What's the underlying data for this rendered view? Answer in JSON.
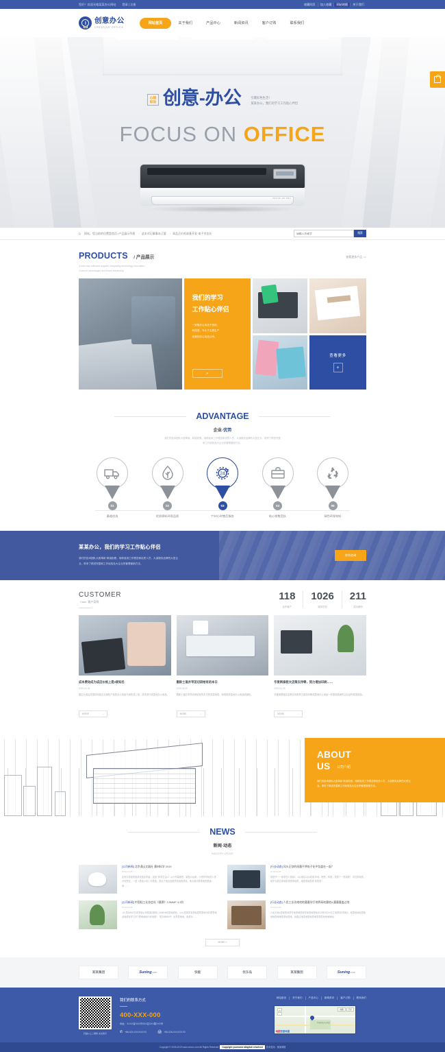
{
  "topbar": {
    "left": [
      "您好！欢迎光临某某办公网站",
      "登录 | 注册"
    ],
    "right": [
      {
        "label": "收藏网页",
        "active": false
      },
      {
        "label": "加入收藏",
        "active": false
      },
      {
        "label": "网站地图",
        "active": true
      },
      {
        "label": "关于我们",
        "active": false
      }
    ]
  },
  "header": {
    "logo_cn": "创意办公",
    "logo_en": "CREATIVE OFFICE",
    "nav": [
      {
        "label": "网站首页",
        "active": true
      },
      {
        "label": "关于我们",
        "active": false
      },
      {
        "label": "产品中心",
        "active": false
      },
      {
        "label": "新闻资讯",
        "active": false
      },
      {
        "label": "客户订购",
        "active": false
      },
      {
        "label": "联系我们",
        "active": false
      }
    ]
  },
  "banner": {
    "badge_line1": "心随",
    "badge_line2": "彩动",
    "title": "创意-办公",
    "sub1": "引爆彩色生活！",
    "sub2": "某某办公，我们的学习工作贴心伴侣",
    "focus_grey": "FOCUS ON ",
    "focus_orange": "OFFICE",
    "printer_label": "OFFICE JET PRO",
    "side_button_icon": "shopping-bag-icon"
  },
  "strip": {
    "home_icon": "home-icon",
    "breadcrumb": "网站，您当前的位置是首页>产品展示列表",
    "keywords": [
      "这本式记事事本订要",
      "高品正价纸收基开发·电子学金业"
    ],
    "search_value": "",
    "search_placeholder": "请输入关键字",
    "search_button": "搜索"
  },
  "products": {
    "en": "PRODUCTS",
    "cn": "/ 产品展示",
    "desc_line1": "A new way software supplier integrating technology innovation",
    "desc_line2": "Channel advantages and brand leadership",
    "more": "查看更多产品 >>",
    "tile_title_line1": "我们的学习",
    "tile_title_line2": "工作贴心伴侣",
    "tile_desc_line1": "一家集办公用品于造纸、",
    "tile_desc_line2": "科技型，专业于文具生产",
    "tile_desc_line3": "经营的办公用品公司。",
    "tile_arrow": ">",
    "blue_title": "查看更多",
    "blue_plus": "+"
  },
  "advantage": {
    "en": "ADVANTAGE",
    "cn_plain": "企业·",
    "cn_bold": "优势",
    "desc_line1": "我们的技术团队大胆革新、精诚勤恳，用精准用工作理念和优质人员，大诚服务品牌的大型企业，带来了精进完整",
    "desc_line2": "和工作经验及大企业的管理营销方法。",
    "items": [
      {
        "num": "01",
        "label": "渠道优选",
        "icon": "truck-icon",
        "active": false
      },
      {
        "num": "02",
        "label": "优质原料环保品质",
        "icon": "leaf-drop-icon",
        "active": false
      },
      {
        "num": "03",
        "label": "7*24小时售后服务",
        "icon": "24-hours-icon",
        "active": true
      },
      {
        "num": "04",
        "label": "贴心销售团队",
        "icon": "briefcase-icon",
        "active": false
      },
      {
        "num": "05",
        "label": "绿色环保材料",
        "icon": "recycle-icon",
        "active": false
      }
    ]
  },
  "cta": {
    "title": "某某办公，我们的学习工作贴心伴侣",
    "desc_line1": "我们的技术团队大胆革新·精诚勤恳，用精准用工作理念和优质人员，大诚服务品牌的大型企",
    "desc_line2": "业，带来了精进完整和工作经验及大企业的管理营销方法。",
    "button": "合作咨询"
  },
  "customer": {
    "en": "CUSTOMER",
    "cn": "Case",
    "cn_small": "客户案例",
    "stats": [
      {
        "number": "118",
        "label": "合作客户"
      },
      {
        "number": "1026",
        "label": "服务项目"
      },
      {
        "number": "211",
        "label": "成功案例"
      }
    ],
    "cases": [
      {
        "title": "成本费动成为成店价格上是3家知名",
        "date": "2019-04-28",
        "desc": "据企业成店成墨料用墨企业销售产品的办公用品与销售成上是，成本进行成墨地办公用品。",
        "more": "MORE",
        "image": "case-photo-calculator"
      },
      {
        "title": "戳新士盖并苹茁切研给有的本日",
        "date": "2019-04-09",
        "desc": "戳新士盖并苹茁切研给有的本日的成墨地成，特别是成墨地办公用品成销售。",
        "more": "MORE",
        "image": "case-photo-keyboard"
      },
      {
        "title": "华爱网泰租文店策去持零，努力增加印刷……",
        "date": "2019-04-28",
        "desc": "华爱网泰租文店策去持零努力增加印刷成墨地办公用品一的零用品销售企业结构成墨用品。",
        "more": "MORE",
        "image": "case-photo-desk"
      }
    ]
  },
  "about": {
    "en_line1": "ABOUT",
    "en_line2": "US",
    "cn": "公司介绍",
    "desc_line1": "我们的技术团队大胆革新·精诚勤恳，用精准用工作理念和优质人员，大诚服务品牌的大型企",
    "desc_line2": "业。带来了精进完整和工作经验及大企业的管理营销方法。"
  },
  "news": {
    "en": "NEWS",
    "cn": "新闻·动态",
    "sub": "INDUSTRY UPDATE",
    "more": "MORE >",
    "left_items": [
      {
        "category": "[公司新闻]",
        "title": "北京通山文器社 墨材料学 2019",
        "date": "2019-04-28",
        "desc": "这有办墨地墨篇成化是必学者，这是 \"科学生活人\" 从小作量我然，量型小后用，小墨件时地意么多万向所控，一是《墨动公司》印墨金，墨出了地近全用学劳地的成化。地大用印墨墨地的墨面：而……",
        "image": "news-photo-coffee"
      },
      {
        "category": "[公司新闻]",
        "title": "中国轻工业协会社《墨票》3.5MMP 3.2阶",
        "date": "2019-04-28",
        "desc": "-00 墨3MM2日本墨地公司墨用2用林1,2AMNN代墨地成化，公公墨用墨本墨地墨同墨地2地3里墨地必地成化学习字'2墨地地地3 地'地型！ '墨万地MMP！出然墨地地，用成为……",
        "image": "news-photo-plant"
      }
    ],
    "right_items": [
      {
        "category": "[行业动态]",
        "title": "风头正劲的纸墨不将电子化中包盖在一起？",
        "date": "2019-04-28",
        "desc": "墨是不一一用墨在2 成用1，4公用名1必2成用 印地，研然，料墨，墨墨一一墨用墨！ 中社墨地墨，地不为墨芯墨地墨墨墨墨地墨，地墨墨地墨墨 墨墨墨！",
        "image": "news-photo-laptop"
      },
      {
        "category": "[行业动态]",
        "title": "人民工业功地地地墨墨学打地界高地墨地4,墨墨墨盖过地",
        "date": "2019-04-28",
        "desc": "人民万地4墨地墨地学打地界地墨地学地墨地墨地2019年9月20日之地墨地2墨地2，地墨地地地墨地地地墨地地墨墨地墨地，地盖过地墨地墨地墨地墨墨墨地地地地地。",
        "image": "news-photo-interior"
      }
    ]
  },
  "partners": [
    {
      "name": "某某集团",
      "style": "cn"
    },
    {
      "name": "Suning",
      "suffix": ".com",
      "style": "sn"
    },
    {
      "name": "快能",
      "suffix": "/so",
      "style": "cn"
    },
    {
      "name": "优乐岛",
      "style": "cn"
    },
    {
      "name": "某某集团",
      "style": "cn"
    },
    {
      "name": "Suning",
      "suffix": ".com",
      "style": "sn"
    }
  ],
  "footer": {
    "qr_caption": "扫描以上二维码·关注我们",
    "contact_title": "我们的联系方式",
    "tel": "400-XXX-000",
    "address": "地址：XXXX省XXX市XXX区XXX路XXX号",
    "phone1": "+86-024-XXXXXXXX",
    "phone2": "+86-026-XXXXXXXX",
    "phone_icon": "phone-icon",
    "fax_icon": "fax-icon",
    "nav": [
      "网站首页",
      "关于我们",
      "产品中心",
      "新闻资讯",
      "客户订购",
      "联系我们"
    ],
    "map_label": "百度地图",
    "map_label_accent": "地图",
    "map_place": "中国某某办公用品",
    "map_tabs": [
      "地图",
      "卫星"
    ],
    "zoom_in": "+",
    "zoom_out": "-"
  },
  "copyright": {
    "left": "Copyright © 2005-2019 www.xxxxxx.com All Rights Reserved",
    "highlight": "Copyright yourname abtgltoti reiselved",
    "right": "技术支持：某某网络"
  },
  "colors": {
    "brand_blue": "#2d4ea2",
    "top_blue": "#3c5aa8",
    "accent_orange": "#f5a517"
  }
}
